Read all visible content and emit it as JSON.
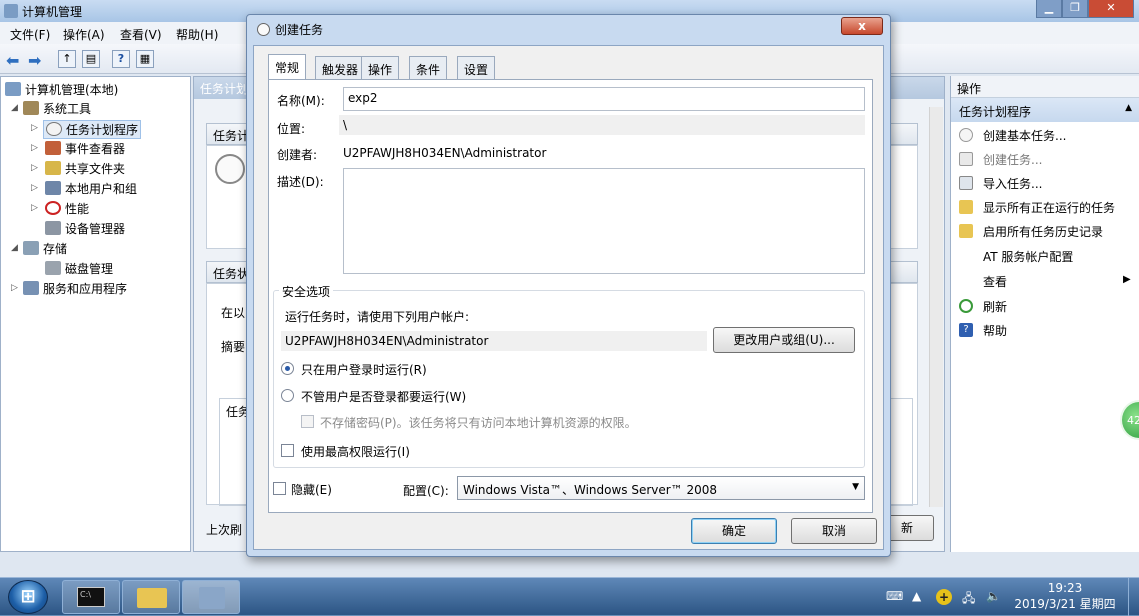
{
  "main_window": {
    "title": "计算机管理",
    "menu": [
      "文件(F)",
      "操作(A)",
      "查看(V)",
      "帮助(H)"
    ],
    "tree": {
      "root": "计算机管理(本地)",
      "system_tools": "系统工具",
      "items": [
        "任务计划程序",
        "事件查看器",
        "共享文件夹",
        "本地用户和组",
        "性能",
        "设备管理器"
      ],
      "storage": "存储",
      "disk": "磁盘管理",
      "services": "服务和应用程序"
    },
    "center": {
      "header": "任务计划",
      "section1": "任务计",
      "section2": "任务状",
      "text1": "在以",
      "text2": "摘要",
      "col": "任务",
      "footer_left": "上次刷",
      "footer_btn": "新"
    },
    "actions": {
      "header": "操作",
      "section": "任务计划程序",
      "items": [
        "创建基本任务...",
        "创建任务...",
        "导入任务...",
        "显示所有正在运行的任务",
        "启用所有任务历史记录",
        "AT 服务帐户配置",
        "查看",
        "刷新",
        "帮助"
      ]
    }
  },
  "dialog": {
    "title": "创建任务",
    "close_label": "x",
    "tabs": [
      "常规",
      "触发器",
      "操作",
      "条件",
      "设置"
    ],
    "name_label": "名称(M):",
    "name_value": "exp2",
    "location_label": "位置:",
    "location_value": "\\",
    "author_label": "创建者:",
    "author_value": "U2PFAWJH8H034EN\\Administrator",
    "desc_label": "描述(D):",
    "security_group": "安全选项",
    "run_as_text": "运行任务时，请使用下列用户帐户:",
    "run_as_user": "U2PFAWJH8H034EN\\Administrator",
    "change_user_btn": "更改用户或组(U)...",
    "radio_logged_on": "只在用户登录时运行(R)",
    "radio_whether": "不管用户是否登录都要运行(W)",
    "no_store_pwd": "不存储密码(P)。该任务将只有访问本地计算机资源的权限。",
    "highest_priv": "使用最高权限运行(I)",
    "hidden_label": "隐藏(E)",
    "config_label": "配置(C):",
    "config_value": "Windows Vista™、Windows Server™ 2008",
    "ok_btn": "确定",
    "cancel_btn": "取消"
  },
  "taskbar": {
    "time": "19:23",
    "date": "2019/3/21 星期四",
    "badge": "42"
  }
}
